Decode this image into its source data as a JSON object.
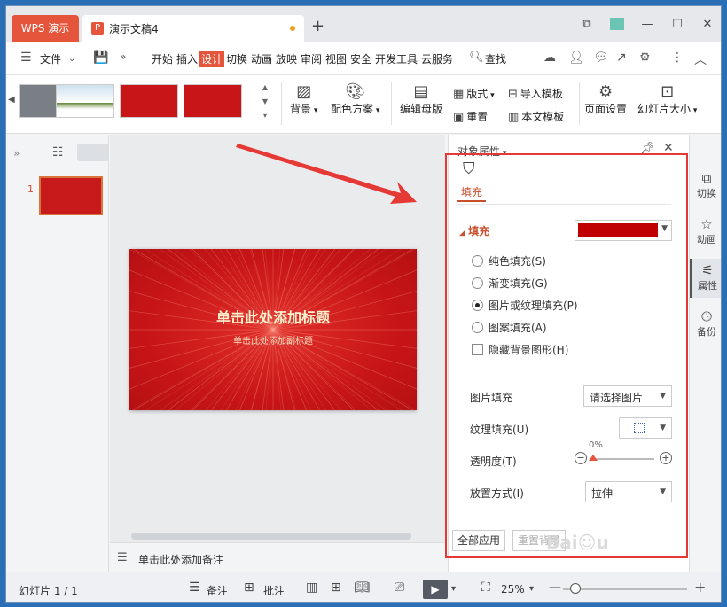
{
  "app": {
    "tab_label": "WPS 演示",
    "doc_title": "演示文稿4",
    "doc_icon": "P"
  },
  "menu": {
    "file": "文件",
    "items": [
      "开始",
      "插入",
      "设计",
      "切换",
      "动画",
      "放映",
      "审阅",
      "视图",
      "安全",
      "开发工具",
      "云服务"
    ],
    "active": "设计",
    "search": "查找"
  },
  "ribbon": {
    "background": "背景",
    "color_scheme": "配色方案",
    "edit_master": "编辑母版",
    "layout": "版式",
    "reset": "重置",
    "import_template": "导入模板",
    "text_template": "本文模板",
    "page_setup": "页面设置",
    "slide_size": "幻灯片大小"
  },
  "thumbnails": {
    "slide_number": "1"
  },
  "slide": {
    "title": "单击此处添加标题",
    "subtitle": "单击此处添加副标题"
  },
  "notes": {
    "placeholder": "单击此处添加备注"
  },
  "panel": {
    "header": "对象属性",
    "tab_fill": "填充",
    "section_fill": "填充",
    "fill_color": "#c00000",
    "options": [
      {
        "label": "纯色填充(S)",
        "checked": false
      },
      {
        "label": "渐变填充(G)",
        "checked": false
      },
      {
        "label": "图片或纹理填充(P)",
        "checked": true
      },
      {
        "label": "图案填充(A)",
        "checked": false
      }
    ],
    "hide_bg": "隐藏背景图形(H)",
    "picture_fill_label": "图片填充",
    "picture_fill_value": "请选择图片",
    "texture_fill_label": "纹理填充(U)",
    "transparency_label": "透明度(T)",
    "transparency_value": "0%",
    "placement_label": "放置方式(I)",
    "placement_value": "拉伸",
    "apply_all": "全部应用",
    "reset_bg": "重置背景"
  },
  "sidebar": {
    "items": [
      "切换",
      "动画",
      "属性",
      "备份"
    ],
    "active": "属性"
  },
  "status": {
    "slide_count": "幻灯片 1 / 1",
    "notes": "备注",
    "comments": "批注",
    "zoom": "25%"
  },
  "colors": {
    "accent": "#e5553b",
    "slide_red": "#c81517",
    "annotation": "#e53935"
  }
}
